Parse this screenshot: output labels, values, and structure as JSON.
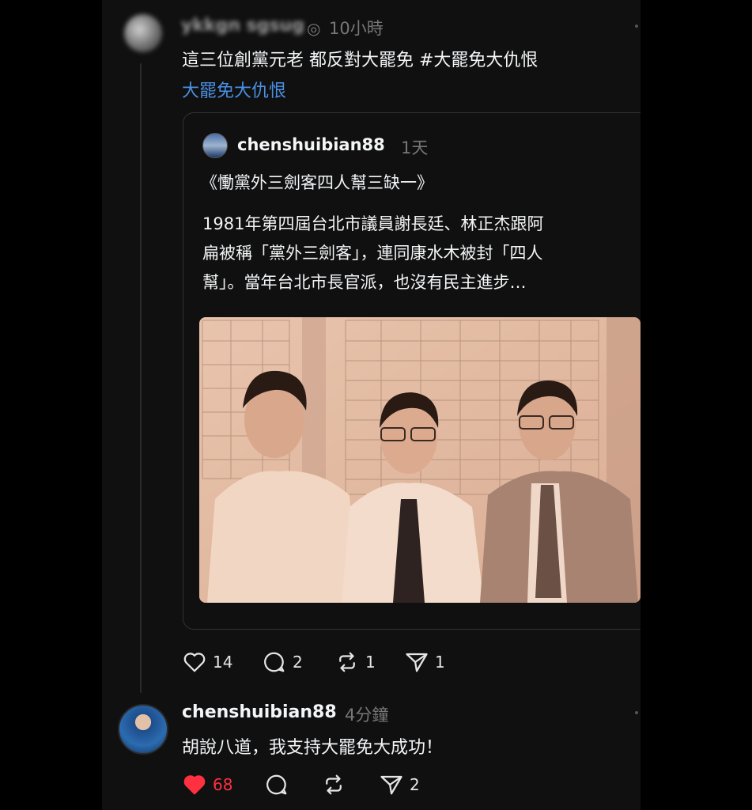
{
  "post": {
    "username": "ykkgn sgsug",
    "time": "10小時",
    "text_line1": "這三位創黨元老 都反對大罷免 #大罷免大仇恨",
    "hashtag_link": "大罷免大仇恨",
    "likes": "14",
    "comments": "2",
    "reposts": "1",
    "shares": "1"
  },
  "quote": {
    "username": "chenshuibian88",
    "time": "1天",
    "title": "《慟黨外三劍客四人幫三缺一》",
    "body_line1": "1981年第四屆台北市議員謝長廷、林正杰跟阿",
    "body_line2": "扁被稱「黨外三劍客」，連同康水木被封「四人",
    "body_line3": "幫」。當年台北市長官派，也沒有民主進步…"
  },
  "reply": {
    "username": "chenshuibian88",
    "time": "4分鐘",
    "text": "胡說八道，我支持大罷免大成功！",
    "likes": "68",
    "shares": "2"
  },
  "colors": {
    "background": "#101010",
    "text": "#f3f5f7",
    "muted": "#777777",
    "link": "#4a90e2",
    "like_active": "#ff3040"
  }
}
